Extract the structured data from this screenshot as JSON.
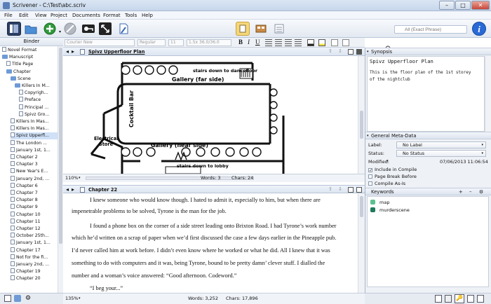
{
  "window": {
    "title": "Scrivener - C:\\Test\\abc.scriv",
    "min": "–",
    "max": "□",
    "close": "✕"
  },
  "menu": [
    "File",
    "Edit",
    "View",
    "Project",
    "Documents",
    "Format",
    "Tools",
    "Help"
  ],
  "format": {
    "font": "Courier New",
    "style": "Regular",
    "size": "11",
    "spacing": "1.5x 36.0/36.0"
  },
  "search": {
    "placeholder": "All (Exact Phrase)"
  },
  "binder": {
    "title": "Binder",
    "items": [
      {
        "label": "Novel Format",
        "indent": 0,
        "type": "doc"
      },
      {
        "label": "Manuscript",
        "indent": 0,
        "type": "folder"
      },
      {
        "label": "Title Page",
        "indent": 1,
        "type": "doc"
      },
      {
        "label": "Chapter",
        "indent": 1,
        "type": "folder"
      },
      {
        "label": "Scene",
        "indent": 2,
        "type": "folder"
      },
      {
        "label": "Killers In M...",
        "indent": 3,
        "type": "folder"
      },
      {
        "label": "Copyrigh...",
        "indent": 4,
        "type": "doc"
      },
      {
        "label": "Preface",
        "indent": 4,
        "type": "doc"
      },
      {
        "label": "Principal ...",
        "indent": 4,
        "type": "doc"
      },
      {
        "label": "Spivz Gro...",
        "indent": 4,
        "type": "doc"
      },
      {
        "label": "Killers In Mas...",
        "indent": 2,
        "type": "doc"
      },
      {
        "label": "Killers In Mas...",
        "indent": 2,
        "type": "doc"
      },
      {
        "label": "Spivz Upperfl...",
        "indent": 2,
        "type": "doc"
      },
      {
        "label": "The London ...",
        "indent": 2,
        "type": "doc"
      },
      {
        "label": "January 1st, 1...",
        "indent": 2,
        "type": "doc"
      },
      {
        "label": "Chapter 2",
        "indent": 2,
        "type": "doc"
      },
      {
        "label": "Chapter 3",
        "indent": 2,
        "type": "doc"
      },
      {
        "label": "New Year's E...",
        "indent": 2,
        "type": "doc"
      },
      {
        "label": "January 2nd, ...",
        "indent": 2,
        "type": "doc"
      },
      {
        "label": "Chapter 6",
        "indent": 2,
        "type": "doc"
      },
      {
        "label": "Chapter 7",
        "indent": 2,
        "type": "doc"
      },
      {
        "label": "Chapter 8",
        "indent": 2,
        "type": "doc"
      },
      {
        "label": "Chapter 9",
        "indent": 2,
        "type": "doc"
      },
      {
        "label": "Chapter 10",
        "indent": 2,
        "type": "doc"
      },
      {
        "label": "Chapter 11",
        "indent": 2,
        "type": "doc"
      },
      {
        "label": "Chapter 12",
        "indent": 2,
        "type": "doc"
      },
      {
        "label": "October 25th...",
        "indent": 2,
        "type": "doc"
      },
      {
        "label": "January 1st, 1...",
        "indent": 2,
        "type": "doc"
      },
      {
        "label": "Chapter 17",
        "indent": 2,
        "type": "doc"
      },
      {
        "label": "Not for the fi...",
        "indent": 2,
        "type": "doc"
      },
      {
        "label": "January 2nd, ...",
        "indent": 2,
        "type": "doc"
      },
      {
        "label": "Chapter 19",
        "indent": 2,
        "type": "doc"
      },
      {
        "label": "Chapter 20",
        "indent": 2,
        "type": "doc"
      }
    ]
  },
  "editor1": {
    "title": "Spivz Upperfloor Plan",
    "zoom": "110%",
    "words": "Words: 3",
    "chars": "Chars: 24"
  },
  "plan": {
    "stairs_top": "stairs down to dancefloor",
    "gallery_far": "Gallery (far side)",
    "gallery_near": "Gallery (near side)",
    "cocktail": "Cocktail Bar",
    "electrical": "Electrical",
    "store": "Store",
    "stairs_bottom": "stairs down to lobby"
  },
  "editor2": {
    "title": "Chapter 22",
    "zoom": "135%",
    "words": "Words: 3,252",
    "chars": "Chars: 17,896",
    "lines": [
      "I knew someone who would know though. I hated to admit it, especially to him, but when there are",
      "impenetrable problems to be solved, Tyrone is the man for the job.",
      "I found a phone box on the corner of a side street leading onto Brixton Road. I had Tyrone’s work number",
      "which he’d written on a scrap of paper when we’d first discussed the case a few days earlier in the Pineapple pub.",
      "I’d never called him at work before. I didn’t even know where he worked or what he did. All I knew that it was",
      "something to do with computers and it was, being Tyrone, bound to be pretty damn’ clever stuff. I dialled the",
      "number and a woman’s voice answered: “Good afternoon. Codeword.”",
      "“I beg your...”"
    ]
  },
  "synopsis": {
    "header": "Synopsis",
    "title": "Spivz Upperfloor Plan",
    "text1": "This is the floor plan of the 1st storey",
    "text2": "of the nightclub"
  },
  "meta": {
    "header": "General Meta-Data",
    "label_k": "Label:",
    "label_v": "No Label",
    "status_k": "Status:",
    "status_v": "No Status",
    "modified_k": "Modified:",
    "modified_v": "07/06/2013 11:06:54",
    "include": "Include in Compile",
    "pagebreak": "Page Break Before",
    "asis": "Compile As-Is"
  },
  "keywords": {
    "header": "Keywords",
    "items": [
      {
        "name": "map",
        "color": "#5ec08f"
      },
      {
        "name": "murderscene",
        "color": "#1f7a5a"
      }
    ]
  },
  "colors": {
    "accent": "#1f4fa0",
    "help": "#2a6ad6",
    "add": "#2e9a3a",
    "keyword_map": "#5ec08f",
    "keyword_murder": "#1f7a5a"
  }
}
